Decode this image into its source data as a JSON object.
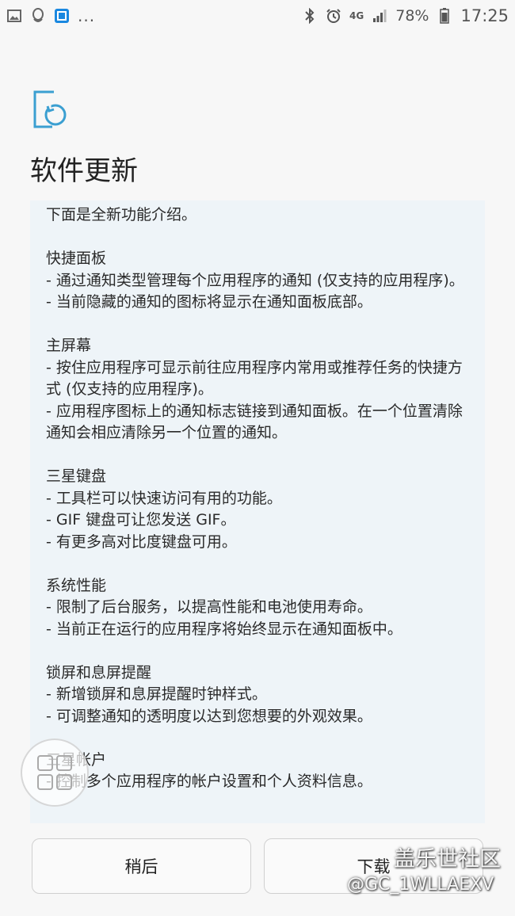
{
  "status_bar": {
    "left_icons": [
      "gallery-icon",
      "qq-icon",
      "app-icon"
    ],
    "more": "...",
    "right_icons": [
      "bluetooth-icon",
      "alarm-icon"
    ],
    "network": "4G",
    "battery": "78%",
    "time": "17:25"
  },
  "header": {
    "icon": "software-update-icon",
    "title": "软件更新"
  },
  "content": {
    "intro": "下面是全新功能介绍。",
    "sections": [
      {
        "title": "快捷面板",
        "items": [
          "- 通过通知类型管理每个应用程序的通知 (仅支持的应用程序)。",
          "- 当前隐藏的通知的图标将显示在通知面板底部。"
        ]
      },
      {
        "title": "主屏幕",
        "items": [
          "- 按住应用程序可显示前往应用程序内常用或推荐任务的快捷方式 (仅支持的应用程序)。",
          "- 应用程序图标上的通知标志链接到通知面板。在一个位置清除通知会相应清除另一个位置的通知。"
        ]
      },
      {
        "title": "三星键盘",
        "items": [
          "- 工具栏可以快速访问有用的功能。",
          "- GIF 键盘可让您发送 GIF。",
          "- 有更多高对比度键盘可用。"
        ]
      },
      {
        "title": "系统性能",
        "items": [
          "- 限制了后台服务，以提高性能和电池使用寿命。",
          "- 当前正在运行的应用程序将始终显示在通知面板中。"
        ]
      },
      {
        "title": "锁屏和息屏提醒",
        "items": [
          "- 新增锁屏和息屏提醒时钟样式。",
          "- 可调整通知的透明度以达到您想要的外观效果。"
        ]
      },
      {
        "title": "三星帐户",
        "items": [
          "- 控制多个应用程序的帐户设置和个人资料信息。"
        ]
      }
    ]
  },
  "buttons": {
    "later": "稍后",
    "download": "下载"
  },
  "watermark": {
    "logo": "盖乐世社区",
    "user": "@GC_1WLLAEXV"
  },
  "colors": {
    "accent": "#3b9fd1",
    "panel_bg": "#eef4f8",
    "page_bg": "#f7f7f7"
  }
}
